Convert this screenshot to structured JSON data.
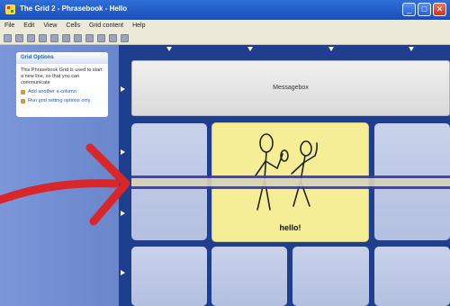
{
  "window": {
    "title": "The Grid 2 - Phrasebook - Hello",
    "minimize_glyph": "_",
    "maximize_glyph": "□",
    "close_glyph": "✕"
  },
  "menu": [
    "File",
    "Edit",
    "View",
    "Cells",
    "Grid content",
    "Help"
  ],
  "toolbar_icons": [
    "new-icon",
    "open-icon",
    "save-icon",
    "cut-icon",
    "copy-icon",
    "paste-icon",
    "undo-icon",
    "redo-icon",
    "grid-icon",
    "cell-icon",
    "settings-icon"
  ],
  "task_pane": {
    "title": "Grid Options",
    "body": "This Phrasebook Grid is used to start a new line, so that you can communicate",
    "links": [
      "Add another a column",
      "Run grid setting options only"
    ]
  },
  "grid": {
    "message_window": "Messagebox",
    "highlighted_cell_label": "hello!"
  },
  "colors": {
    "title_bar": "#2f6fd8",
    "grid_background": "#1f3f8e",
    "cell": "#c8d2ea",
    "highlight_cell": "#f6ee97",
    "scan_bar": "#3e3c9a",
    "arrow": "#d8262a"
  }
}
